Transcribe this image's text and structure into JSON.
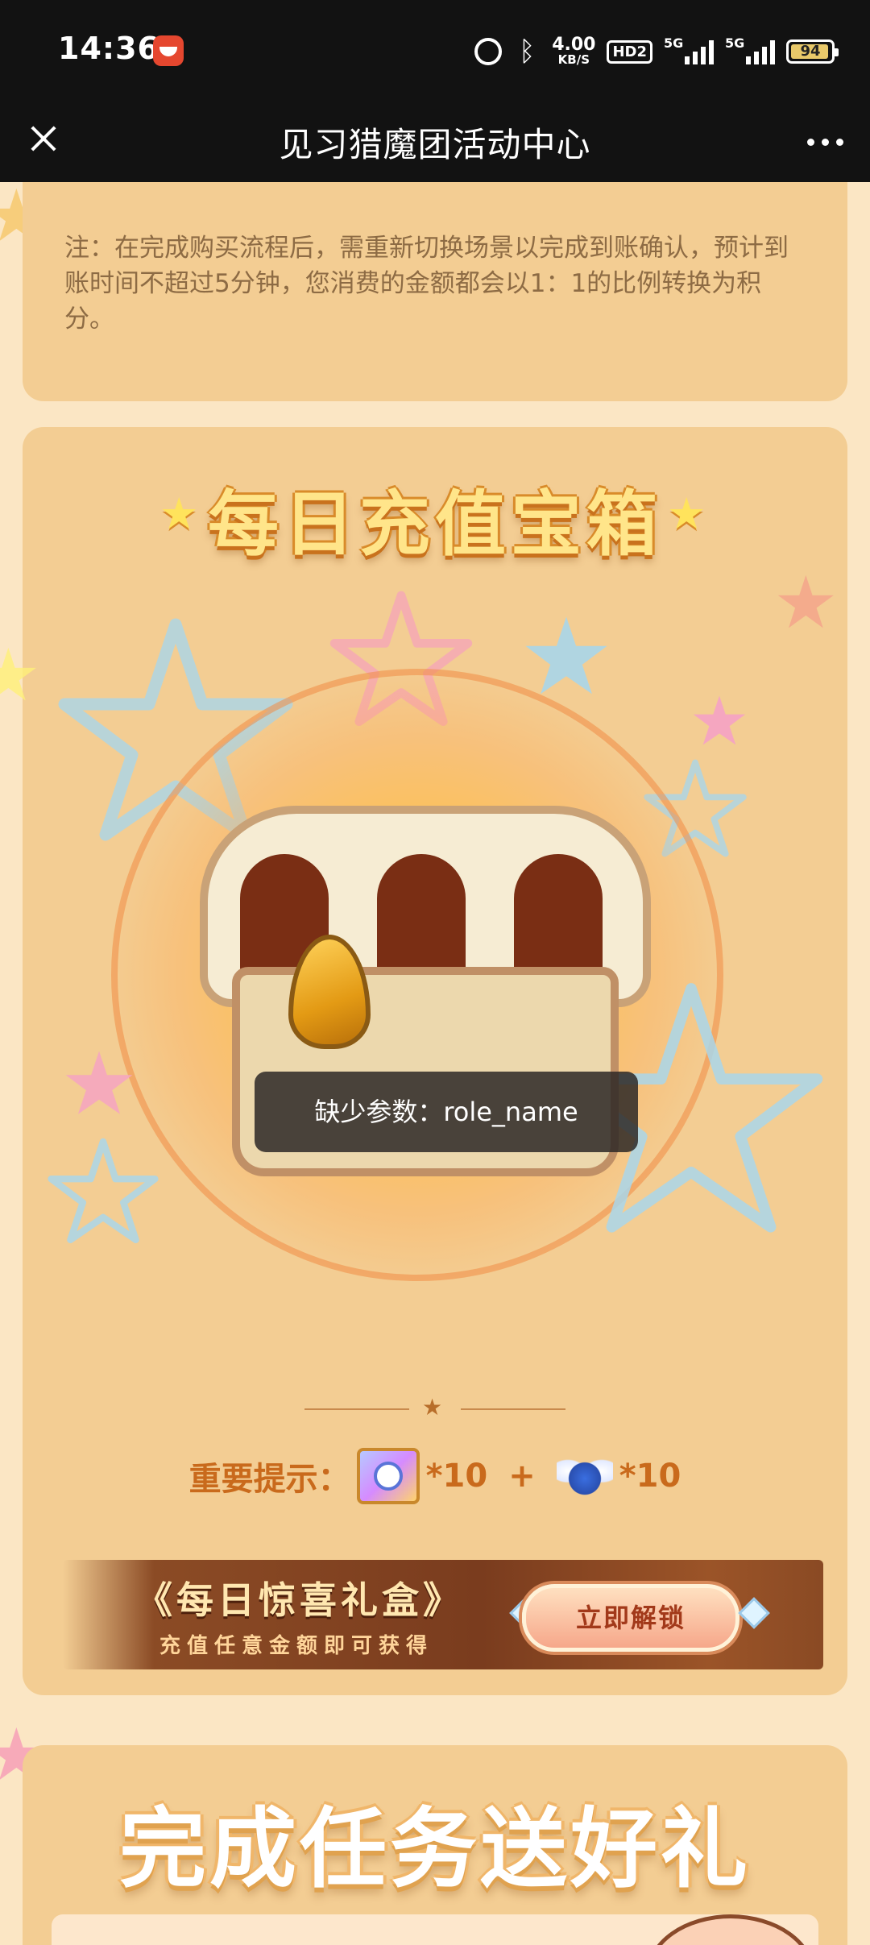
{
  "status_bar": {
    "time": "14:36",
    "net_speed": "4.00\nKB/S",
    "net_speed_value": "4.00",
    "net_speed_unit": "KB/S",
    "hd_badge": "HD2",
    "net_label_1": "5G",
    "net_label_2": "5G",
    "battery": "94",
    "icons": [
      "app-notification-icon",
      "alarm-icon",
      "bluetooth-icon",
      "hd-icon",
      "signal-5g-icon",
      "signal-5g-icon",
      "battery-icon"
    ]
  },
  "title_bar": {
    "title": "见习猎魔团活动中心",
    "close_icon": "close-icon",
    "more_icon": "more-icon"
  },
  "note": {
    "text": "注：在完成购买流程后，需重新切换场景以完成到账确认，预计到账时间不超过5分钟，您消费的金额都会以1：1的比例转换为积分。"
  },
  "daily_chest": {
    "title": "每日充值宝箱",
    "toast": "缺少参数：role_name",
    "tip_label": "重要提示：",
    "reward_1_qty": "*10",
    "plus": "+",
    "reward_2_qty": "*10"
  },
  "banner": {
    "title": "《每日惊喜礼盒》",
    "subtitle": "充值任意金额即可获得",
    "button_label": "立即解锁"
  },
  "task_section": {
    "title": "完成任务送好礼"
  },
  "colors": {
    "background": "#fbe6c4",
    "card": "#f3cd93",
    "tip_text": "#c96a1c",
    "status_bar": "#121212"
  }
}
